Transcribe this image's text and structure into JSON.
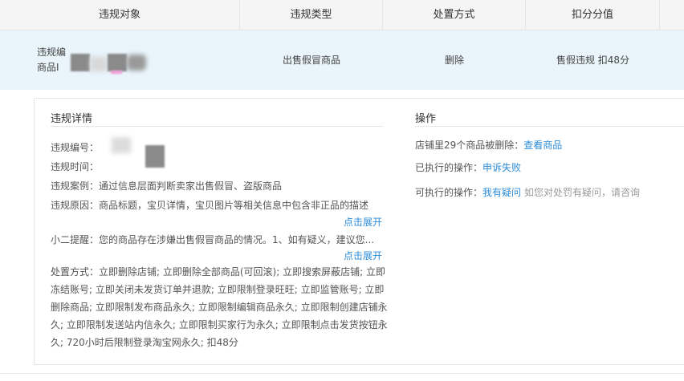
{
  "table": {
    "headers": [
      "违规对象",
      "违规类型",
      "处置方式",
      "扣分分值"
    ],
    "row": {
      "object_line1": "违规编",
      "object_line2": "商品I",
      "type": "出售假冒商品",
      "action": "删除",
      "score": "售假违规 扣48分"
    }
  },
  "detail": {
    "title": "违规详情",
    "id_label": "违规编号：",
    "time_label": "违规时间：",
    "case_label": "违规案例：",
    "case_value": "通过信息层面判断卖家出售假冒、盗版商品",
    "reason_label": "违规原因：",
    "reason_value": "商品标题，宝贝详情，宝贝图片等相关信息中包含非正品的描述",
    "expand1": "点击展开",
    "tip_label": "小二提醒：",
    "tip_value": "您的商品存在涉嫌出售假冒商品的情况。1、如有疑义，建议您...",
    "expand2": "点击展开",
    "measures": "处置方式：立即删除店铺; 立即删除全部商品(可回滚); 立即搜索屏蔽店铺; 立即冻结账号; 立即关闭未发货订单并退款; 立即限制登录旺旺; 立即监管账号; 立即删除商品; 立即限制发布商品永久; 立即限制编辑商品永久; 立即限制创建店铺永久; 立即限制发送站内信永久; 立即限制买家行为永久; 立即限制点击发货按钮永久; 720小时后限制登录淘宝网永久; 扣48分"
  },
  "operations": {
    "title": "操作",
    "deleted_prefix": "店铺里29个商品被删除：",
    "deleted_link": "查看商品",
    "executed_label": "已执行的操作：",
    "executed_link": "申诉失败",
    "available_label": "可执行的操作：",
    "available_link": "我有疑问",
    "available_hint": "如您对处罚有疑问，请咨询"
  }
}
